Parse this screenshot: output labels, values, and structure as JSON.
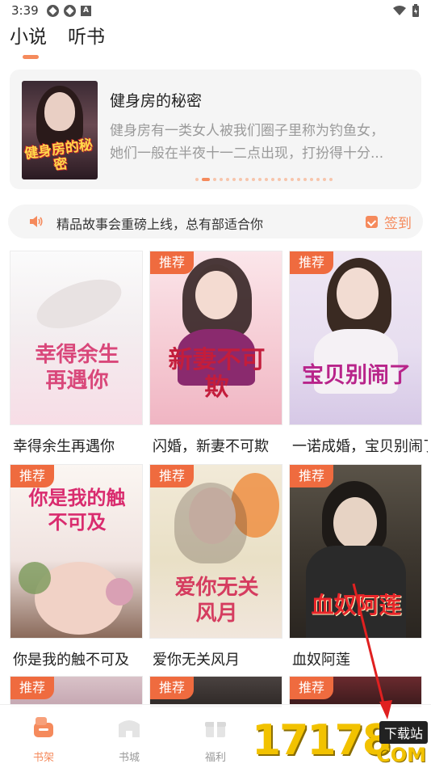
{
  "status_bar": {
    "time": "3:39"
  },
  "tabs": [
    {
      "label": "小说"
    },
    {
      "label": "听书"
    }
  ],
  "featured": {
    "cover_title": "健身房的秘密",
    "title": "健身房的秘密",
    "desc_line1": "健身房有一类女人被我们圈子里称为钓鱼女，",
    "desc_line2": "她们一般在半夜十一二点出现，打扮得十分..."
  },
  "notice": {
    "text": "精品故事会重磅上线，总有部适合你",
    "signin_label": "签到"
  },
  "books": [
    {
      "title": "幸得余生再遇你",
      "cover_text": "幸得余生再遇你",
      "badge": ""
    },
    {
      "title": "闪婚，新妻不可欺",
      "cover_text": "新妻不可欺",
      "badge": "推荐"
    },
    {
      "title": "一诺成婚，宝贝别闹了",
      "cover_text": "宝贝别闹了",
      "badge": "推荐"
    },
    {
      "title": "你是我的触不可及",
      "cover_text": "你是我的触不可及",
      "badge": "推荐"
    },
    {
      "title": "爱你无关风月",
      "cover_text": "爱你无关风月",
      "badge": "推荐"
    },
    {
      "title": "血奴阿莲",
      "cover_text": "血奴阿莲",
      "badge": "推荐"
    },
    {
      "title": "",
      "cover_text": "",
      "badge": "推荐"
    },
    {
      "title": "",
      "cover_text": "",
      "badge": "推荐"
    },
    {
      "title": "",
      "cover_text": "",
      "badge": "推荐"
    }
  ],
  "bottom_nav": [
    {
      "label": "书架",
      "icon": "bookshelf-icon",
      "active": true
    },
    {
      "label": "书城",
      "icon": "bookstore-icon",
      "active": false
    },
    {
      "label": "福利",
      "icon": "gift-icon",
      "active": false
    }
  ],
  "watermark": {
    "number": "17178",
    "box_label": "下载站",
    "domain": "COM"
  },
  "colors": {
    "accent": "#f58a5c",
    "badge": "#ef6b3f",
    "background": "#ffffff",
    "card_bg": "#f5f5f5"
  }
}
